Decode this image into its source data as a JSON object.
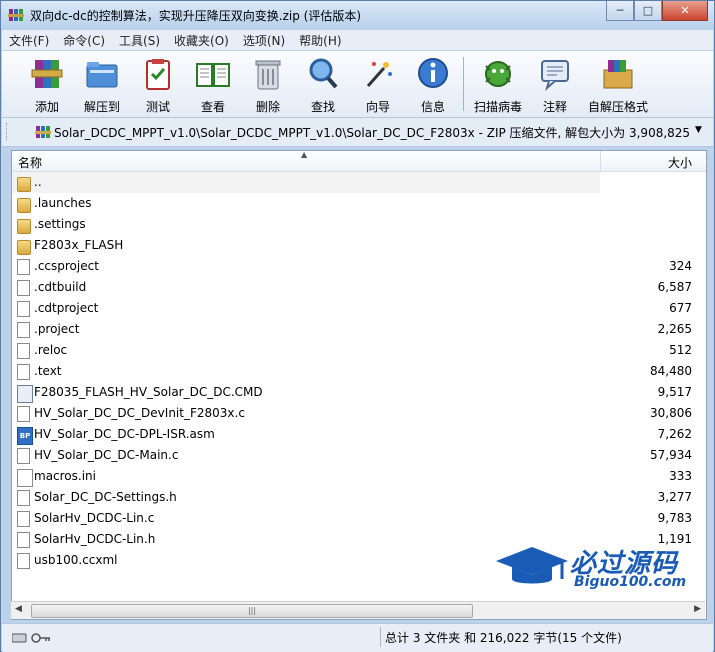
{
  "window": {
    "title": "双向dc-dc的控制算法，实现升压降压双向变换.zip (评估版本)",
    "buttons": {
      "minimize": "─",
      "maximize": "□",
      "close": "✕"
    }
  },
  "menu": [
    "文件(F)",
    "命令(C)",
    "工具(S)",
    "收藏夹(O)",
    "选项(N)",
    "帮助(H)"
  ],
  "toolbar": {
    "add": "添加",
    "extract": "解压到",
    "test": "测试",
    "view": "查看",
    "delete": "删除",
    "find": "查找",
    "wizard": "向导",
    "info": "信息",
    "virus": "扫描病毒",
    "comment": "注释",
    "sfx": "自解压格式"
  },
  "address": {
    "path": "Solar_DCDC_MPPT_v1.0\\Solar_DCDC_MPPT_v1.0\\Solar_DC_DC_F2803x - ZIP 压缩文件, 解包大小为 3,908,825 字节"
  },
  "columns": {
    "name": "名称",
    "size": "大小"
  },
  "files": [
    {
      "name": "..",
      "size": "",
      "type": "folder"
    },
    {
      "name": ".launches",
      "size": "",
      "type": "folder"
    },
    {
      "name": ".settings",
      "size": "",
      "type": "folder"
    },
    {
      "name": "F2803x_FLASH",
      "size": "",
      "type": "folder"
    },
    {
      "name": ".ccsproject",
      "size": "324",
      "type": "doc"
    },
    {
      "name": ".cdtbuild",
      "size": "6,587",
      "type": "doc"
    },
    {
      "name": ".cdtproject",
      "size": "677",
      "type": "doc"
    },
    {
      "name": ".project",
      "size": "2,265",
      "type": "doc"
    },
    {
      "name": ".reloc",
      "size": "512",
      "type": "doc"
    },
    {
      "name": ".text",
      "size": "84,480",
      "type": "doc"
    },
    {
      "name": "F28035_FLASH_HV_Solar_DC_DC.CMD",
      "size": "9,517",
      "type": "cmd"
    },
    {
      "name": "HV_Solar_DC_DC_DevInit_F2803x.c",
      "size": "30,806",
      "type": "doc"
    },
    {
      "name": "HV_Solar_DC_DC-DPL-ISR.asm",
      "size": "7,262",
      "type": "asm"
    },
    {
      "name": "HV_Solar_DC_DC-Main.c",
      "size": "57,934",
      "type": "doc"
    },
    {
      "name": "macros.ini",
      "size": "333",
      "type": "ini"
    },
    {
      "name": "Solar_DC_DC-Settings.h",
      "size": "3,277",
      "type": "doc"
    },
    {
      "name": "SolarHv_DCDC-Lin.c",
      "size": "9,783",
      "type": "doc"
    },
    {
      "name": "SolarHv_DCDC-Lin.h",
      "size": "1,191",
      "type": "doc"
    },
    {
      "name": "usb100.ccxml",
      "size": "",
      "type": "doc"
    }
  ],
  "status": {
    "summary": "总计 3 文件夹 和 216,022 字节(15 个文件)"
  },
  "watermark": {
    "main": "必过源码",
    "sub": "Biguo100.com"
  }
}
